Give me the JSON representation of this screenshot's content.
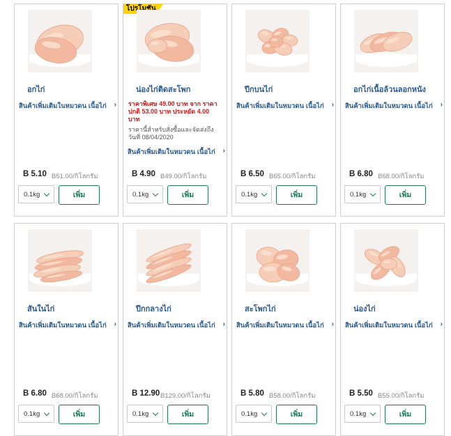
{
  "products": [
    {
      "name": "อกไก่",
      "related": "สินค้าเพิ่มเติมในหมวดน เนื้อไก่",
      "price": "B 5.10",
      "unit_price": "B51.00/กิโลกรัม",
      "qty": "0.1kg",
      "add": "เพิ่ม",
      "image": "chicken-breast"
    },
    {
      "name": "น่องไก่ติดสะโพก",
      "promo_badge": "โปรโมชั่น",
      "promo_text": "ราคาพิเศษ 49.00 บาท จาก ราคาปกติ 53.00 บาท ประหยัด 4.00 บาท",
      "promo_note": "ราคานี้สำหรับสั่งซื้อและจัดส่งถึงวันที่ 08/04/2020",
      "related": "สินค้าเพิ่มเติมในหมวดน เนื้อไก่",
      "price": "B 4.90",
      "unit_price": "B49.00/กิโลกรัม",
      "qty": "0.1kg",
      "add": "เพิ่ม",
      "image": "thigh-leg"
    },
    {
      "name": "ปีกบนไก่",
      "related": "สินค้าเพิ่มเติมในหมวดน เนื้อไก่",
      "price": "B 6.50",
      "unit_price": "B65.00/กิโลกรัม",
      "qty": "0.1kg",
      "add": "เพิ่ม",
      "image": "wing-pieces"
    },
    {
      "name": "อกไก่เนื้อล้วนลอกหนัง",
      "related": "สินค้าเพิ่มเติมในหมวดน เนื้อไก่",
      "price": "B 6.80",
      "unit_price": "B68.00/กิโลกรัม",
      "qty": "0.1kg",
      "add": "เพิ่ม",
      "image": "skinless-breast"
    },
    {
      "name": "สันในไก่",
      "related": "สินค้าเพิ่มเติมในหมวดน เนื้อไก่",
      "price": "B 6.80",
      "unit_price": "B68.00/กิโลกรัม",
      "qty": "0.1kg",
      "add": "เพิ่ม",
      "image": "tenderloin"
    },
    {
      "name": "ปีกกลางไก่",
      "related": "สินค้าเพิ่มเติมในหมวดน เนื้อไก่",
      "price": "B 12.90",
      "unit_price": "B129.00/กิโลกรัม",
      "qty": "0.1kg",
      "add": "เพิ่ม",
      "image": "mid-wings"
    },
    {
      "name": "สะโพกไก่",
      "related": "สินค้าเพิ่มเติมในหมวดน เนื้อไก่",
      "price": "B 5.80",
      "unit_price": "B58.00/กิโลกรัม",
      "qty": "0.1kg",
      "add": "เพิ่ม",
      "image": "thighs"
    },
    {
      "name": "น่องไก่",
      "related": "สินค้าเพิ่มเติมในหมวดน เนื้อไก่",
      "price": "B 5.50",
      "unit_price": "B55.00/กิโลกรัม",
      "qty": "0.1kg",
      "add": "เพิ่ม",
      "image": "drumsticks"
    }
  ],
  "colors": {
    "accent": "#1d7a52",
    "link": "#2a5a90",
    "promo": "#c81c1c",
    "badge": "#ffd400"
  }
}
